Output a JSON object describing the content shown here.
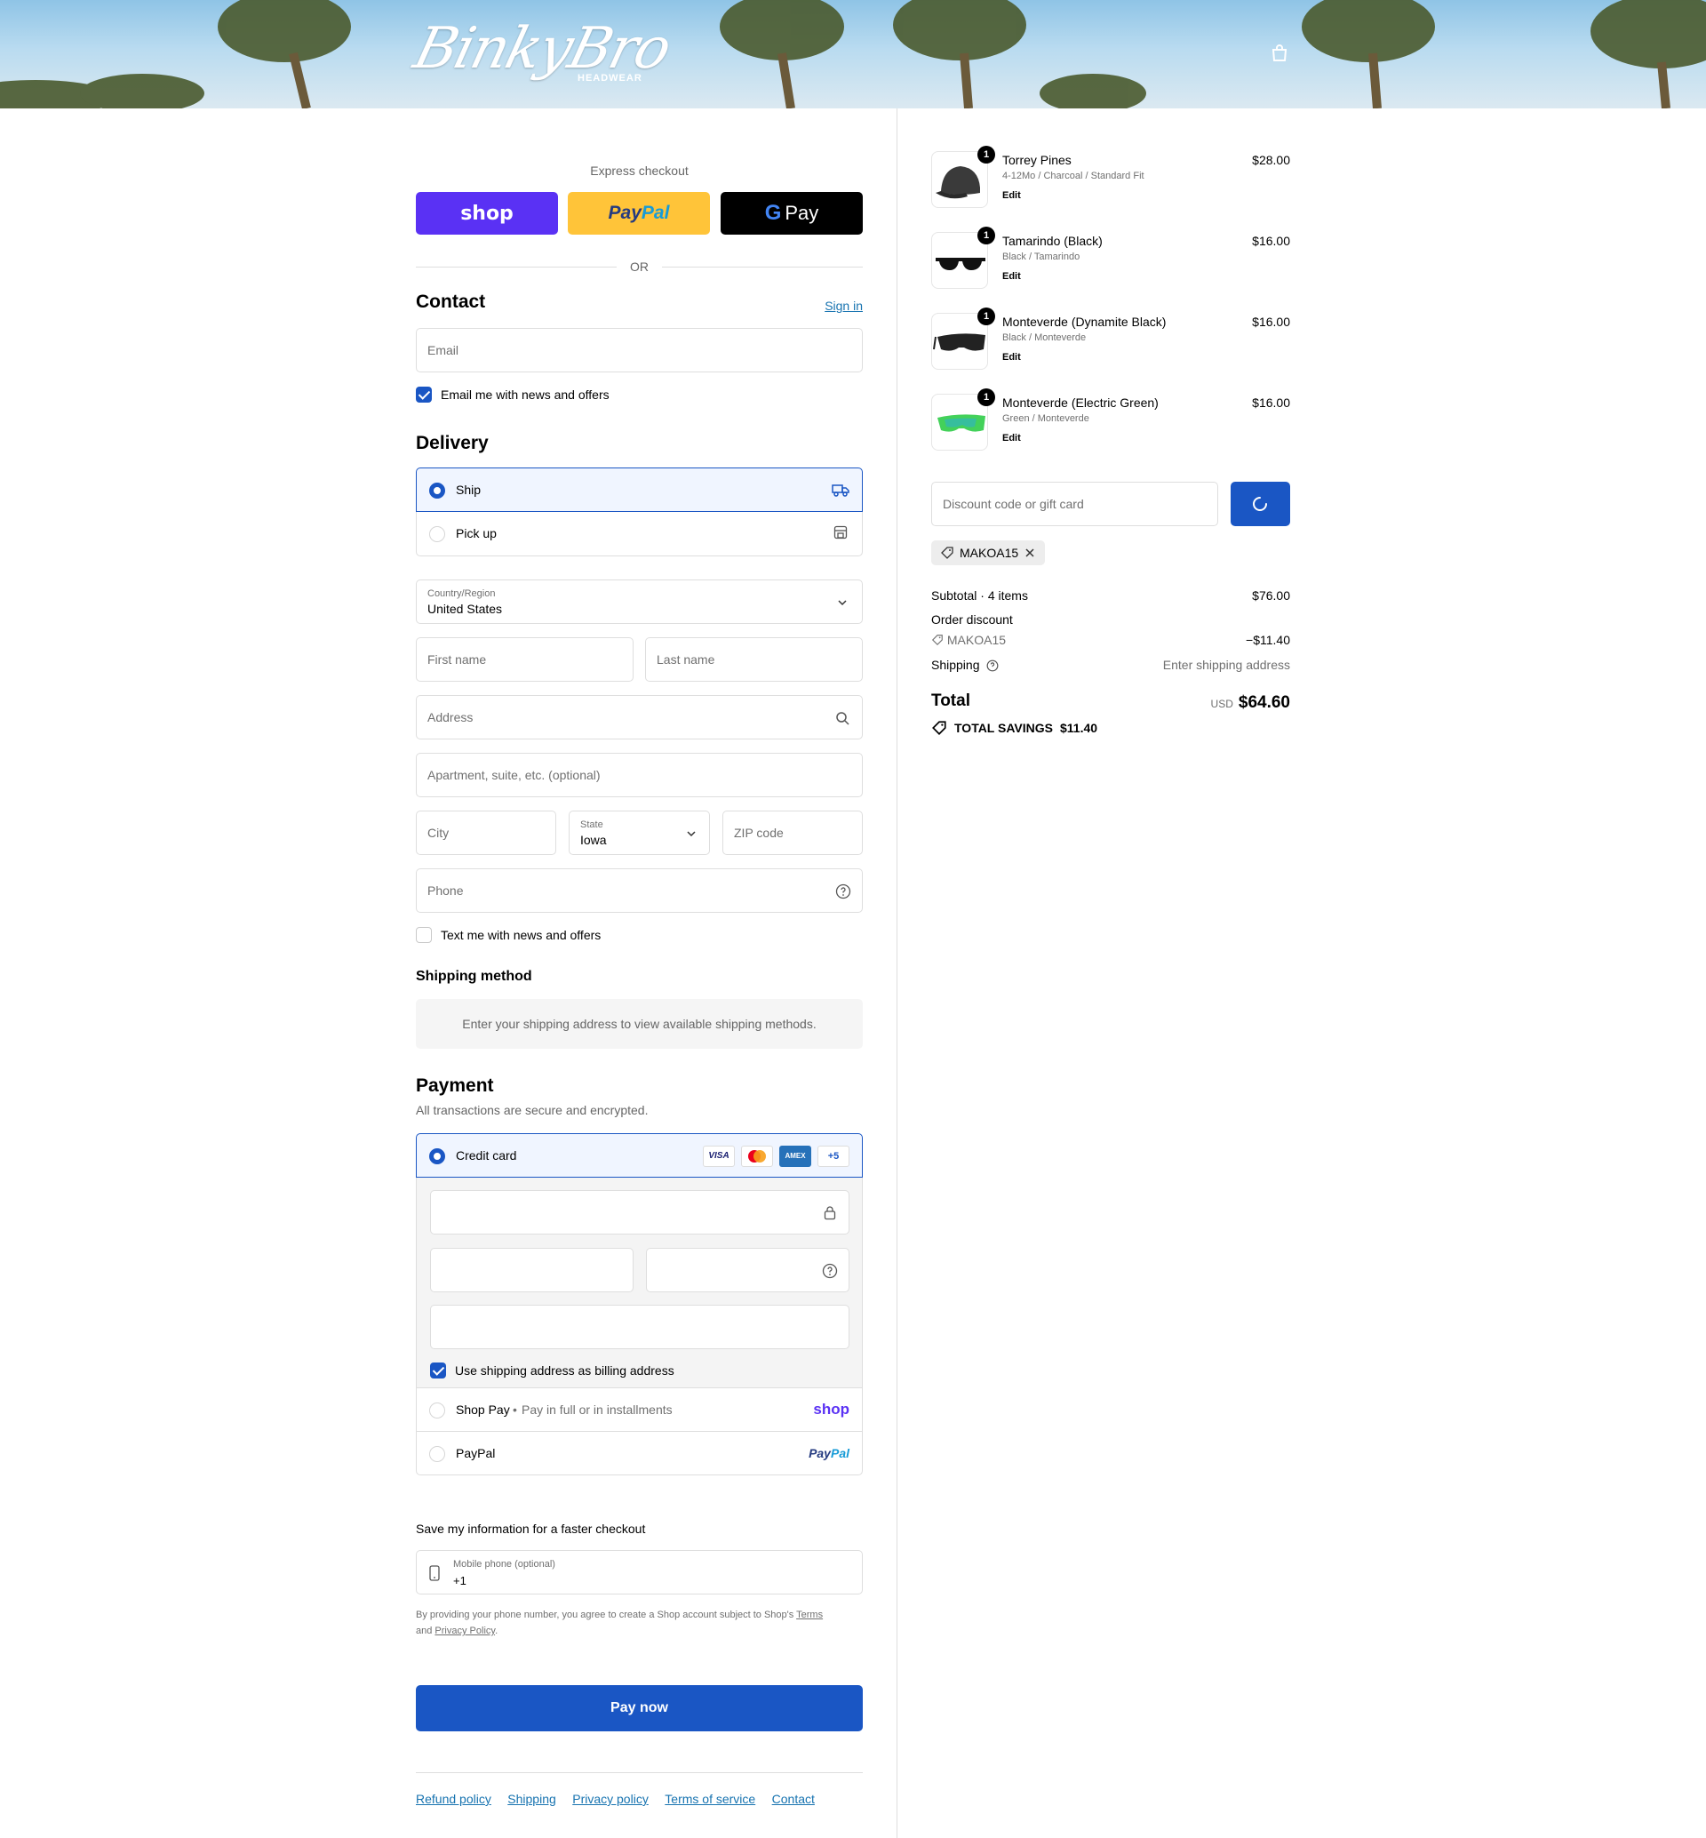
{
  "brand": {
    "logo_text": "BinkyBro",
    "logo_sub": "HEADWEAR"
  },
  "icons": {
    "cart": "shopping-bag-icon",
    "ship": "truck-icon",
    "pickup": "store-icon",
    "search": "search-icon",
    "help": "question-circle-icon",
    "lock": "lock-icon",
    "tag": "tag-icon",
    "mobile": "mobile-phone-icon",
    "close": "close-icon",
    "spinner": "spinner-icon",
    "chevron": "chevron-down-icon"
  },
  "colors": {
    "accent": "#1a56c4",
    "shop": "#5a31f4",
    "paypal": "#ffc439",
    "gpay": "#000000",
    "link": "#1773b0"
  },
  "express": {
    "title": "Express checkout",
    "shop": "shop",
    "paypal_a": "Pay",
    "paypal_b": "Pal",
    "gpay": "Pay",
    "or": "OR"
  },
  "contact": {
    "title": "Contact",
    "signin": "Sign in",
    "email_placeholder": "Email",
    "newsletter": "Email me with news and offers",
    "newsletter_checked": true
  },
  "delivery": {
    "title": "Delivery",
    "ship": "Ship",
    "pickup": "Pick up",
    "selected": "Ship",
    "country_label": "Country/Region",
    "country": "United States",
    "first_name": "First name",
    "last_name": "Last name",
    "address": "Address",
    "apartment": "Apartment, suite, etc. (optional)",
    "city": "City",
    "state_label": "State",
    "state": "Iowa",
    "zip": "ZIP code",
    "phone": "Phone",
    "sms": "Text me with news and offers",
    "sms_checked": false
  },
  "shipping_method": {
    "title": "Shipping method",
    "message": "Enter your shipping address to view available shipping methods."
  },
  "payment": {
    "title": "Payment",
    "subtitle": "All transactions are secure and encrypted.",
    "credit_card": "Credit card",
    "card_badges": [
      "VISA",
      "AMEX"
    ],
    "more_cards": "+5",
    "billing_same": "Use shipping address as billing address",
    "billing_checked": true,
    "shop_pay": "Shop Pay",
    "shop_pay_note": "Pay in full or in installments",
    "shop_pay_logo": "shop",
    "paypal": "PayPal",
    "paypal_logo_a": "Pay",
    "paypal_logo_b": "Pal"
  },
  "save_info": {
    "title": "Save my information for a faster checkout",
    "mobile_label": "Mobile phone (optional)",
    "mobile_value": "+1",
    "legal_a": "By providing your phone number, you agree to create a Shop account subject to Shop's",
    "terms": "Terms",
    "legal_and": "and",
    "privacy": "Privacy Policy",
    "legal_end": "."
  },
  "pay_now": "Pay now",
  "footer_links": [
    "Refund policy",
    "Shipping",
    "Privacy policy",
    "Terms of service",
    "Contact"
  ],
  "cart": {
    "items": [
      {
        "qty": "1",
        "name": "Torrey Pines",
        "variant": "4-12Mo / Charcoal / Standard Fit",
        "edit": "Edit",
        "price": "$28.00",
        "thumb": "hat"
      },
      {
        "qty": "1",
        "name": "Tamarindo (Black)",
        "variant": "Black / Tamarindo",
        "edit": "Edit",
        "price": "$16.00",
        "thumb": "sunglasses-black"
      },
      {
        "qty": "1",
        "name": "Monteverde (Dynamite Black)",
        "variant": "Black / Monteverde",
        "edit": "Edit",
        "price": "$16.00",
        "thumb": "sport-glasses-black"
      },
      {
        "qty": "1",
        "name": "Monteverde (Electric Green)",
        "variant": "Green / Monteverde",
        "edit": "Edit",
        "price": "$16.00",
        "thumb": "sport-glasses-green"
      }
    ],
    "discount_placeholder": "Discount code or gift card",
    "applied_code": "MAKOA15",
    "subtotal_label": "Subtotal · 4 items",
    "subtotal": "$76.00",
    "order_discount": "Order discount",
    "discount_code": "MAKOA15",
    "discount_amount": "−$11.40",
    "shipping_label": "Shipping",
    "shipping_value": "Enter shipping address",
    "total_label": "Total",
    "currency": "USD",
    "total": "$64.60",
    "savings_label": "TOTAL SAVINGS",
    "savings": "$11.40"
  }
}
